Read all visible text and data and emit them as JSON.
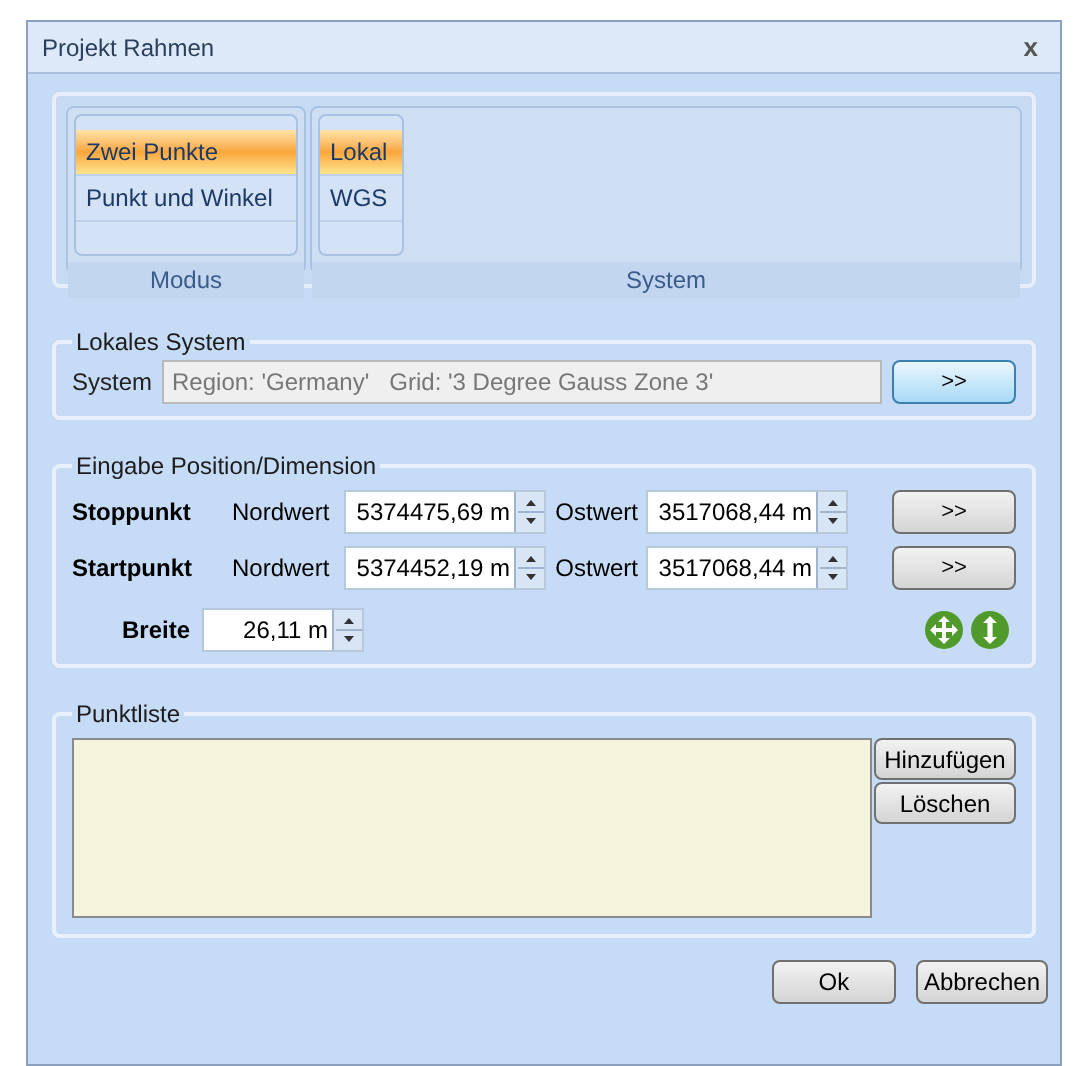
{
  "window": {
    "title": "Projekt Rahmen",
    "close": "x"
  },
  "ribbon": {
    "groups": [
      {
        "label": "Modus",
        "items": [
          {
            "label": "Zwei Punkte",
            "selected": true
          },
          {
            "label": "Punkt und Winkel",
            "selected": false
          }
        ]
      },
      {
        "label": "System",
        "items": [
          {
            "label": "Lokal",
            "selected": true
          },
          {
            "label": "WGS",
            "selected": false
          }
        ]
      }
    ]
  },
  "local_system": {
    "title": "Lokales System",
    "label": "System",
    "value": "Region: 'Germany'   Grid: '3 Degree Gauss Zone 3'",
    "button": ">>"
  },
  "input": {
    "title": "Eingabe Position/Dimension",
    "points": [
      {
        "label": "Stoppunkt",
        "north_label": "Nordwert",
        "north": "5374475,69 m",
        "east_label": "Ostwert",
        "east": "3517068,44 m",
        "button": ">>"
      },
      {
        "label": "Startpunkt",
        "north_label": "Nordwert",
        "north": "5374452,19 m",
        "east_label": "Ostwert",
        "east": "3517068,44 m",
        "button": ">>"
      }
    ],
    "width_label": "Breite",
    "width": "26,11 m"
  },
  "point_list": {
    "title": "Punktliste",
    "buttons": [
      "Hinzufügen",
      "Löschen"
    ]
  },
  "buttons": [
    "Ok",
    "Abbrechen"
  ]
}
